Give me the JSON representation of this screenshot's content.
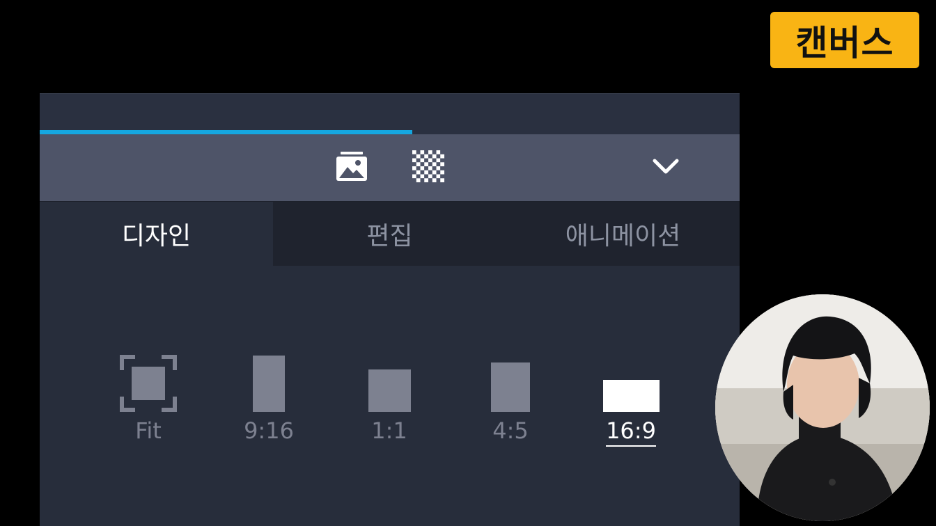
{
  "channel": {
    "badge": "캔버스"
  },
  "timeline": {
    "progress_fraction": 0.532
  },
  "toolbar": {
    "tools": [
      {
        "icon": "image-icon"
      },
      {
        "icon": "transparency-checker-icon"
      },
      {
        "icon": "chevron-down-icon"
      }
    ]
  },
  "tabs": [
    {
      "label": "디자인",
      "active": true
    },
    {
      "label": "편집",
      "active": false
    },
    {
      "label": "애니메이션",
      "active": false
    }
  ],
  "ratios": [
    {
      "label": "Fit",
      "icon": "fit-frame-icon",
      "active": false
    },
    {
      "label": "9:16",
      "active": false
    },
    {
      "label": "1:1",
      "active": false
    },
    {
      "label": "4:5",
      "active": false
    },
    {
      "label": "16:9",
      "active": true
    }
  ],
  "colors": {
    "accent_progress": "#15a7e0",
    "badge_background": "#f9b414",
    "panel_background": "#272d3b",
    "toolbar_background": "#4e5468"
  }
}
